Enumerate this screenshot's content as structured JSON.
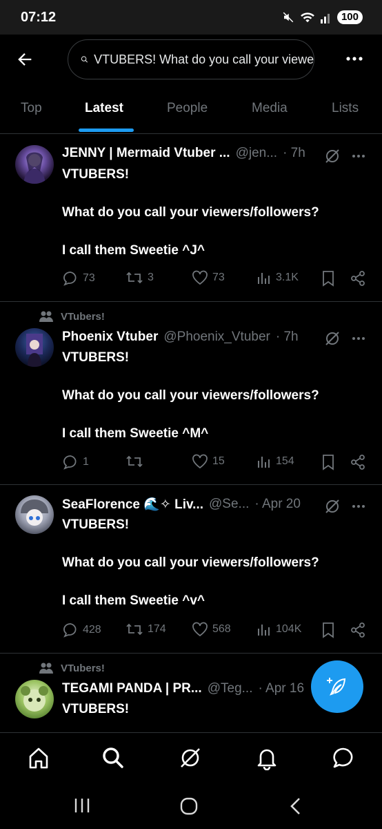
{
  "status_bar": {
    "time": "07:12",
    "battery": "100",
    "icons": [
      "mute-icon",
      "wifi-icon",
      "signal-icon",
      "battery-icon"
    ]
  },
  "header": {
    "search_query": "VTUBERS!  What do you call your viewers/followers? I call them Sweetie",
    "back_icon": "arrow-left-icon",
    "more_icon": "more-horizontal-icon"
  },
  "tabs": [
    {
      "label": "Top",
      "active": false
    },
    {
      "label": "Latest",
      "active": true
    },
    {
      "label": "People",
      "active": false
    },
    {
      "label": "Media",
      "active": false
    },
    {
      "label": "Lists",
      "active": false
    }
  ],
  "tweets": [
    {
      "social_context": "",
      "name": "JENNY | Mermaid Vtuber ...",
      "handle": "@jen...",
      "time": "· 7h",
      "lines": [
        "VTUBERS!",
        "",
        "What do you call your viewers/followers?",
        "",
        "I call them Sweetie ^J^"
      ],
      "replies": "73",
      "retweets": "3",
      "likes": "73",
      "views": "3.1K"
    },
    {
      "social_context": "VTubers!",
      "name": "Phoenix Vtuber",
      "handle": "@Phoenix_Vtuber",
      "time": "· 7h",
      "lines": [
        "VTUBERS!",
        "",
        "What do you call your viewers/followers?",
        "",
        "I call them Sweetie ^M^"
      ],
      "replies": "1",
      "retweets": "",
      "likes": "15",
      "views": "154"
    },
    {
      "social_context": "",
      "name": "SeaFlorence 🌊✧ Liv...",
      "handle": "@Se...",
      "time": "· Apr 20",
      "lines": [
        "VTUBERS!",
        "",
        "What do you call your viewers/followers?",
        "",
        "I call them Sweetie ^v^"
      ],
      "replies": "428",
      "retweets": "174",
      "likes": "568",
      "views": "104K"
    },
    {
      "social_context": "VTubers!",
      "name": "TEGAMI PANDA | PR...",
      "handle": "@Teg...",
      "time": "· Apr 16",
      "lines": [
        "VTUBERS!"
      ],
      "replies": "",
      "retweets": "",
      "likes": "",
      "views": ""
    }
  ],
  "fab": {
    "icon": "compose-feather-icon"
  },
  "bottom_nav": [
    "home-icon",
    "search-icon",
    "grok-icon",
    "notifications-icon",
    "messages-icon"
  ],
  "colors": {
    "accent": "#1d9bf0",
    "background": "#000000",
    "text": "#e7e9ea",
    "muted": "#71767b",
    "divider": "#2f3336"
  }
}
